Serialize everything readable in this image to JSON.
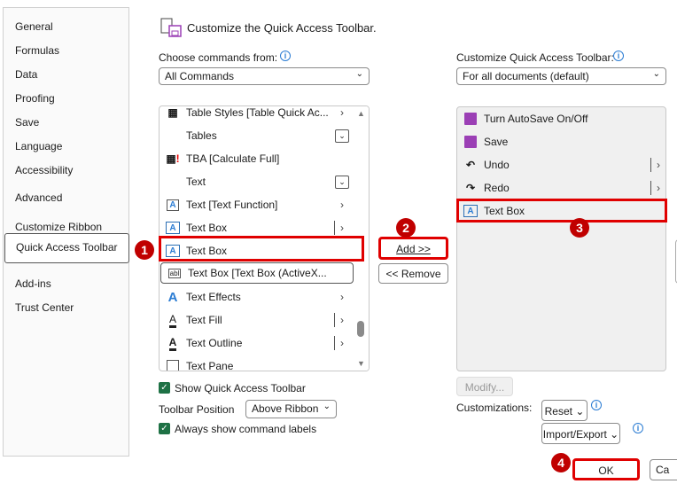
{
  "sidebar": {
    "items": [
      "General",
      "Formulas",
      "Data",
      "Proofing",
      "Save",
      "Language",
      "Accessibility",
      "Advanced",
      "Customize Ribbon",
      "Quick Access Toolbar",
      "Add-ins",
      "Trust Center"
    ],
    "selected": "Quick Access Toolbar"
  },
  "header": {
    "title": "Customize the Quick Access Toolbar."
  },
  "left": {
    "label": "Choose commands from:",
    "dropdown": "All Commands",
    "commands": [
      {
        "label": "Table Styles [Table Quick Ac...",
        "icon": "table-styles-icon",
        "arrow": true
      },
      {
        "label": "Tables",
        "icon": "",
        "dropdown": true
      },
      {
        "label": "TBA [Calculate Full]",
        "icon": "calculator-icon"
      },
      {
        "label": "Text",
        "icon": "",
        "dropdown": true
      },
      {
        "label": "Text [Text Function]",
        "icon": "text-function-icon",
        "arrow": true
      },
      {
        "label": "Text Box",
        "icon": "text-box-icon",
        "split": true
      },
      {
        "label": "Text Box",
        "icon": "text-box-icon",
        "highlighted": true
      },
      {
        "label": "Text Box [Text Box (ActiveX...",
        "icon": "activex-textbox-icon",
        "focused": true
      },
      {
        "label": "Text Effects",
        "icon": "text-effects-icon",
        "arrow": true
      },
      {
        "label": "Text Fill",
        "icon": "text-fill-icon",
        "split": true
      },
      {
        "label": "Text Outline",
        "icon": "text-outline-icon",
        "split": true
      },
      {
        "label": "Text Pane",
        "icon": "text-pane-icon"
      }
    ]
  },
  "right": {
    "label": "Customize Quick Access Toolbar:",
    "dropdown": "For all documents (default)",
    "items": [
      {
        "label": "Turn AutoSave On/Off",
        "icon": "save-icon"
      },
      {
        "label": "Save",
        "icon": "save-icon"
      },
      {
        "label": "Undo",
        "icon": "undo-icon",
        "split": true
      },
      {
        "label": "Redo",
        "icon": "redo-icon",
        "split": true
      },
      {
        "label": "Text Box",
        "icon": "text-box-icon",
        "highlighted": true
      }
    ]
  },
  "buttons": {
    "add": "Add >>",
    "remove": "<< Remove",
    "modify": "Modify...",
    "reset": "Reset",
    "import_export": "Import/Export",
    "ok": "OK",
    "cancel": "Ca"
  },
  "options": {
    "show_qat": "Show Quick Access Toolbar",
    "show_qat_checked": true,
    "position_label": "Toolbar Position",
    "position_value": "Above Ribbon",
    "always_labels": "Always show command labels",
    "always_labels_checked": true,
    "customizations": "Customizations:"
  },
  "badges": [
    "1",
    "2",
    "3",
    "4"
  ],
  "colors": {
    "accent_red": "#e00000",
    "badge": "#c00000",
    "check": "#1e7145",
    "save_icon": "#9b3fb5"
  }
}
